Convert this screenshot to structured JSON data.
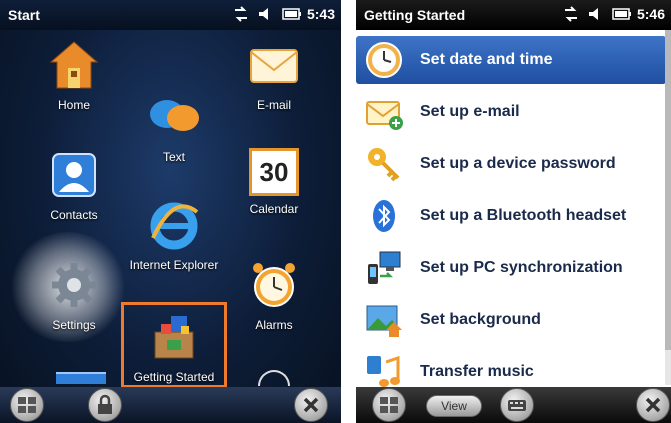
{
  "left": {
    "status": {
      "title": "Start",
      "time": "5:43"
    },
    "tiles": {
      "home": "Home",
      "text": "Text",
      "email": "E-mail",
      "contacts": "Contacts",
      "calendar": "Calendar",
      "calendar_day": "30",
      "internet_explorer": "Internet Explorer",
      "settings": "Settings",
      "getting_started": "Getting Started",
      "alarms": "Alarms"
    }
  },
  "right": {
    "status": {
      "title": "Getting Started",
      "time": "5:46"
    },
    "items": [
      {
        "label": "Set date and time",
        "icon": "clock-icon",
        "selected": true
      },
      {
        "label": "Set up e-mail",
        "icon": "envelope-icon",
        "selected": false
      },
      {
        "label": "Set up a device password",
        "icon": "key-icon",
        "selected": false
      },
      {
        "label": "Set up a Bluetooth headset",
        "icon": "bluetooth-icon",
        "selected": false
      },
      {
        "label": "Set up PC synchronization",
        "icon": "sync-icon",
        "selected": false
      },
      {
        "label": "Set background",
        "icon": "background-icon",
        "selected": false
      },
      {
        "label": "Transfer music",
        "icon": "music-icon",
        "selected": false
      }
    ],
    "bottombar": {
      "view_label": "View"
    }
  },
  "colors": {
    "accent": "#ef7a2c",
    "selection": "#2a5cb0"
  }
}
